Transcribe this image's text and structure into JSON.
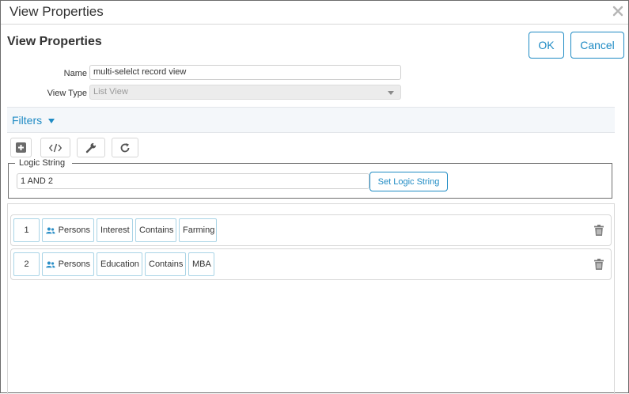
{
  "window": {
    "title": "View Properties"
  },
  "header": {
    "title": "View Properties",
    "ok_label": "OK",
    "cancel_label": "Cancel"
  },
  "form": {
    "name_label": "Name",
    "name_value": "multi-selelct record view",
    "view_type_label": "View Type",
    "view_type_value": "List View"
  },
  "filters": {
    "title": "Filters",
    "toolbar": [
      "add-icon",
      "code-icon",
      "wrench-icon",
      "refresh-icon"
    ],
    "logic_legend": "Logic String",
    "logic_value": "1 AND 2",
    "set_logic_label": "Set Logic String",
    "rows": [
      {
        "index": "1",
        "object": "Persons",
        "field": "Interest",
        "operator": "Contains",
        "value": "Farming"
      },
      {
        "index": "2",
        "object": "Persons",
        "field": "Education",
        "operator": "Contains",
        "value": "MBA"
      }
    ]
  },
  "colors": {
    "accent": "#1f8bc4",
    "border": "#d8d8d8"
  }
}
